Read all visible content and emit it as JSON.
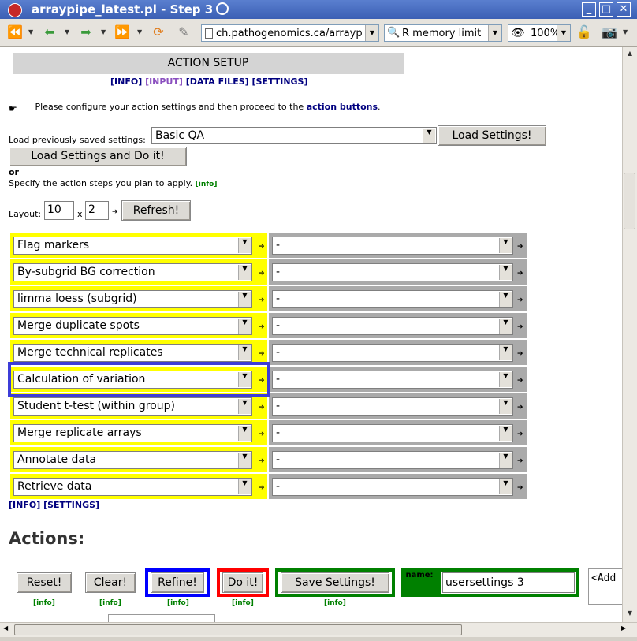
{
  "window": {
    "title": "arraypipe_latest.pl - Step 3"
  },
  "toolbar": {
    "url": "ch.pathogenomics.ca/arraypip",
    "search": "R memory limit",
    "zoom": "100%"
  },
  "page": {
    "header": "ACTION SETUP",
    "nav": {
      "info": "[INFO]",
      "input": "[INPUT]",
      "data_files": "[DATA FILES]",
      "settings": "[SETTINGS]"
    },
    "instruction": {
      "text": "Please configure your action settings and then proceed to the ",
      "highlight": "action buttons",
      "end": "."
    },
    "load": {
      "label": "Load previously saved settings:",
      "selected": "Basic QA",
      "load_button": "Load Settings!",
      "load_do_button": "Load Settings and Do it!"
    },
    "or_text": "or",
    "specify": {
      "text": "Specify the action steps you plan to apply.",
      "info": "[info]"
    },
    "layout": {
      "label": "Layout:",
      "cols": "10",
      "times": "x",
      "rows": "2",
      "refresh_button": "Refresh!"
    },
    "steps": [
      "Flag markers",
      "By-subgrid BG correction",
      "limma loess (subgrid)",
      "Merge duplicate spots",
      "Merge technical replicates",
      "Calculation of variation",
      "Student t-test (within group)",
      "Merge replicate arrays",
      "Annotate data",
      "Retrieve data"
    ],
    "second_column_value": "-",
    "bottom_links": {
      "info": "[INFO]",
      "settings": "[SETTINGS]"
    },
    "actions": {
      "title": "Actions:",
      "reset": "Reset!",
      "clear": "Clear!",
      "refine": "Refine!",
      "doit": "Do it!",
      "save": "Save Settings!",
      "name_label": "name:",
      "name_value": "usersettings 3",
      "add_text": "<Add",
      "info": "[info]"
    }
  },
  "colors": {
    "yellow": "#ffff00",
    "gray": "#aaaaaa",
    "blue_frame": "#0000ff",
    "red_frame": "#ff0000",
    "green_frame": "#008000",
    "highlight": "#3d3dd8"
  }
}
